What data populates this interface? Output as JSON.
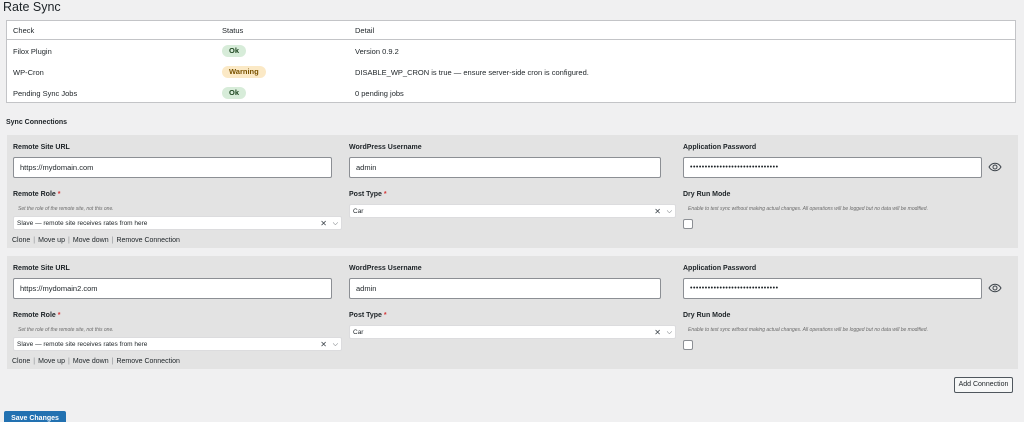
{
  "page": {
    "title": "Rate Sync"
  },
  "status_table": {
    "headers": [
      "Check",
      "Status",
      "Detail"
    ],
    "rows": [
      {
        "check": "Filox Plugin",
        "status": "Ok",
        "status_kind": "ok",
        "detail": "Version 0.9.2"
      },
      {
        "check": "WP-Cron",
        "status": "Warning",
        "status_kind": "warning",
        "detail": "DISABLE_WP_CRON is true — ensure server-side cron is configured."
      },
      {
        "check": "Pending Sync Jobs",
        "status": "Ok",
        "status_kind": "ok",
        "detail": "0 pending jobs"
      }
    ]
  },
  "sync": {
    "section_title": "Sync Connections",
    "labels": {
      "remote_url": "Remote Site URL",
      "username": "WordPress Username",
      "password": "Application Password",
      "role": "Remote Role",
      "post_type": "Post Type",
      "dry_run": "Dry Run Mode",
      "required_mark": "*"
    },
    "help": {
      "role": "Set the role of the remote site, not this one.",
      "dry_run": "Enable to test sync without making actual changes. All operations will be logged but no data will be modified."
    },
    "actions": [
      "Clone",
      "Move up",
      "Move down",
      "Remove Connection"
    ],
    "connections": [
      {
        "url": "https://mydomain.com",
        "username": "admin",
        "password_mask": "••••••••••••••••••••••••••••••",
        "role": "Slave — remote site receives rates from here",
        "post_type": "Car",
        "dry_run": false
      },
      {
        "url": "https://mydomain2.com",
        "username": "admin",
        "password_mask": "••••••••••••••••••••••••••••••",
        "role": "Slave — remote site receives rates from here",
        "post_type": "Car",
        "dry_run": false
      }
    ],
    "add_label": "Add Connection"
  },
  "footer": {
    "save_label": "Save Changes"
  },
  "colors": {
    "accent": "#2271b1",
    "ok_bg": "#d7ecd9",
    "warning_bg": "#fbe9c6",
    "required": "#d63638"
  },
  "icons": {
    "password_toggle": "eye-icon",
    "clear": "clear-x-icon",
    "dropdown": "chevron-down-icon"
  }
}
